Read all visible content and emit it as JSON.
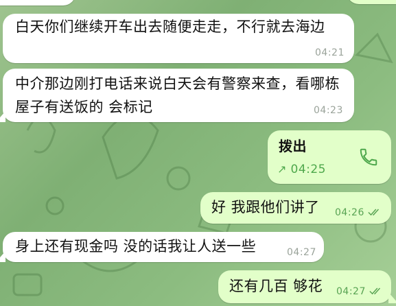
{
  "colors": {
    "incoming_bubble": "#ffffff",
    "outgoing_bubble": "#e2ffc9",
    "timestamp_in": "#9aa39a",
    "timestamp_out": "#58a353",
    "accent_green": "#4ea84c",
    "wallpaper": "#8cbc80"
  },
  "messages": [
    {
      "direction": "in",
      "text": "白天你们继续开车出去随便走走，不行就去海边",
      "time": "04:21"
    },
    {
      "direction": "in",
      "text": "中介那边刚打电话来说白天会有警察来查，看哪栋屋子有送饭的 会标记",
      "time": "04:23"
    },
    {
      "direction": "out",
      "type": "call",
      "title": "拨出",
      "time": "04:25",
      "icon": "phone-icon",
      "arrow_icon": "outgoing-arrow-icon"
    },
    {
      "direction": "out",
      "text": "好 我跟他们讲了",
      "time": "04:26",
      "status": "read"
    },
    {
      "direction": "in",
      "text": "身上还有现金吗 没的话我让人送一些",
      "time": "04:27"
    },
    {
      "direction": "out",
      "text": "还有几百 够花",
      "time": "04:27",
      "status": "read"
    }
  ]
}
